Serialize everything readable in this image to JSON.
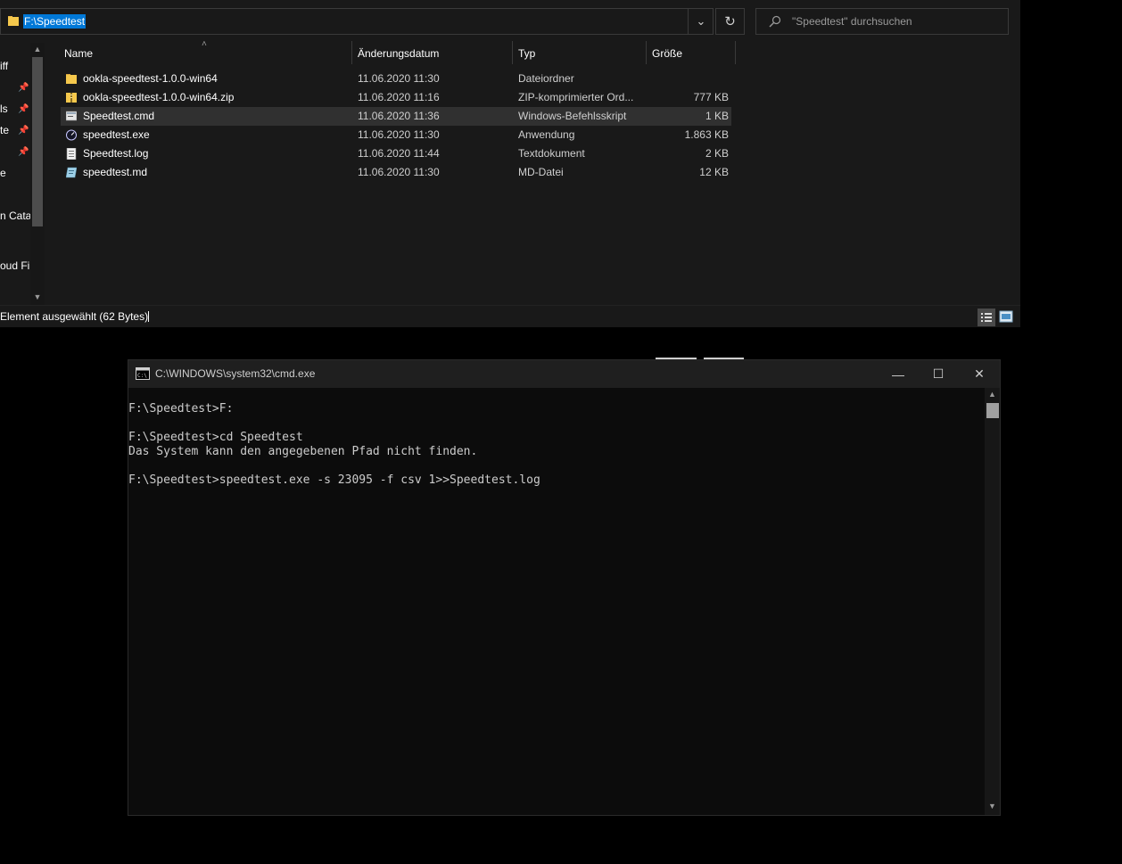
{
  "explorer": {
    "address": "F:\\Speedtest",
    "search_placeholder": "\"Speedtest\" durchsuchen",
    "nav_labels": [
      "iff",
      "ls",
      "te",
      "e",
      "n Catal",
      "oud Fil"
    ],
    "columns": {
      "name": "Name",
      "date": "Änderungsdatum",
      "type": "Typ",
      "size": "Größe"
    },
    "files": [
      {
        "name": "ookla-speedtest-1.0.0-win64",
        "date": "11.06.2020 11:30",
        "type": "Dateiordner",
        "size": "",
        "icon": "folder-icon"
      },
      {
        "name": "ookla-speedtest-1.0.0-win64.zip",
        "date": "11.06.2020 11:16",
        "type": "ZIP-komprimierter Ord...",
        "size": "777 KB",
        "icon": "zip-folder-icon"
      },
      {
        "name": "Speedtest.cmd",
        "date": "11.06.2020 11:36",
        "type": "Windows-Befehlsskript",
        "size": "1 KB",
        "icon": "script-icon"
      },
      {
        "name": "speedtest.exe",
        "date": "11.06.2020 11:30",
        "type": "Anwendung",
        "size": "1.863 KB",
        "icon": "speedtest-app-icon"
      },
      {
        "name": "Speedtest.log",
        "date": "11.06.2020 11:44",
        "type": "Textdokument",
        "size": "2 KB",
        "icon": "text-document-icon"
      },
      {
        "name": "speedtest.md",
        "date": "11.06.2020 11:30",
        "type": "MD-Datei",
        "size": "12 KB",
        "icon": "md-file-icon"
      }
    ],
    "status": "Element ausgewählt (62 Bytes)"
  },
  "cmd": {
    "title": "C:\\WINDOWS\\system32\\cmd.exe",
    "lines": [
      "F:\\Speedtest>F:",
      "",
      "F:\\Speedtest>cd Speedtest",
      "Das System kann den angegebenen Pfad nicht finden.",
      "",
      "F:\\Speedtest>speedtest.exe -s 23095 -f csv 1>>Speedtest.log"
    ]
  },
  "colors": {
    "selection": "#0078d7",
    "window_bg": "#191919",
    "console_bg": "#0c0c0c",
    "console_text": "#cccccc"
  }
}
